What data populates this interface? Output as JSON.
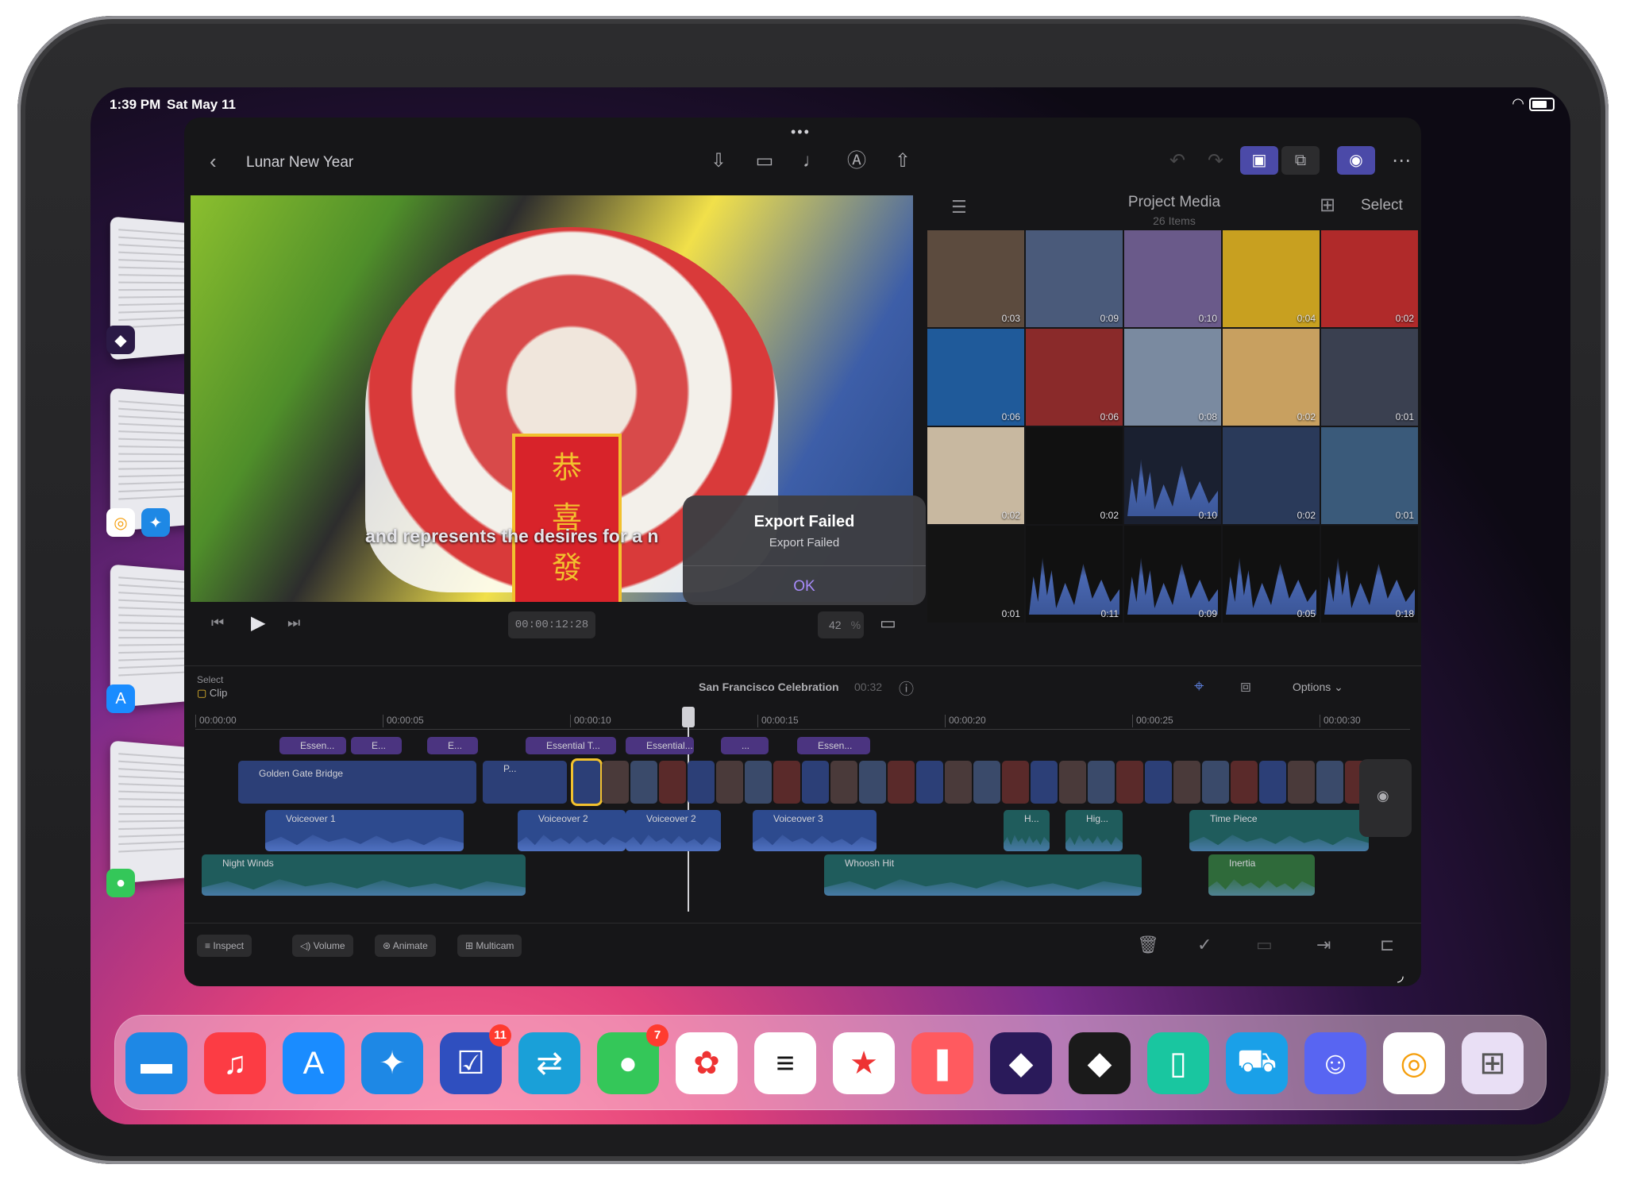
{
  "status": {
    "time": "1:39 PM",
    "date": "Sat May 11"
  },
  "app": {
    "project_title": "Lunar New Year",
    "viewer": {
      "subtitle": "and represents the desires for a n",
      "timecode": "00:00:12:28",
      "zoom": "42",
      "zoom_unit": "%",
      "banner_chars": [
        "恭",
        "喜",
        "發"
      ]
    },
    "dialog": {
      "title": "Export Failed",
      "message": "Export Failed",
      "ok": "OK"
    },
    "media": {
      "title": "Project Media",
      "count": "26 Items",
      "select": "Select",
      "thumbs": [
        {
          "dur": "0:03"
        },
        {
          "dur": "0:09"
        },
        {
          "dur": "0:10"
        },
        {
          "dur": "0:04"
        },
        {
          "dur": "0:02"
        },
        {
          "dur": "0:06"
        },
        {
          "dur": "0:06"
        },
        {
          "dur": "0:08"
        },
        {
          "dur": "0:02"
        },
        {
          "dur": "0:01"
        },
        {
          "dur": "0:02"
        },
        {
          "dur": "0:02"
        },
        {
          "dur": "0:10"
        },
        {
          "dur": "0:02"
        },
        {
          "dur": "0:01"
        },
        {
          "dur": "0:01"
        },
        {
          "dur": "0:11"
        },
        {
          "dur": "0:09"
        },
        {
          "dur": "0:05"
        },
        {
          "dur": "0:18"
        }
      ]
    },
    "timeline": {
      "select_label": "Select",
      "clip_label": "Clip",
      "project_name": "San Francisco Celebration",
      "duration": "00:32",
      "options": "Options",
      "ruler": [
        "00:00:00",
        "00:00:05",
        "00:00:10",
        "00:00:15",
        "00:00:20",
        "00:00:25",
        "00:00:30"
      ],
      "titles": [
        "Essen...",
        "E...",
        "E...",
        "Essential T...",
        "Essential...",
        "...",
        "Essen..."
      ],
      "main_clip": "Golden Gate Bridge",
      "main_clip_short": "P...",
      "voiceovers": [
        "Voiceover 1",
        "Voiceover 2",
        "Voiceover 2",
        "Voiceover 3",
        "H...",
        "Hig...",
        "Time Piece"
      ],
      "music": [
        "Night Winds",
        "Whoosh Hit",
        "Inertia"
      ]
    },
    "footer": {
      "inspect": "Inspect",
      "volume": "Volume",
      "animate": "Animate",
      "multicam": "Multicam"
    }
  },
  "dock": {
    "badges": {
      "tasks": "11",
      "messages": "7"
    },
    "icons": [
      "files-icon",
      "music-icon",
      "app-store-icon",
      "safari-icon",
      "tasks-icon",
      "transfer-icon",
      "messages-icon",
      "photos-icon",
      "notes-stack-icon",
      "bookmark-star-icon",
      "bookmark-icon",
      "shortcuts-icon",
      "obsidian-icon",
      "device-icon",
      "car-icon",
      "discord-icon",
      "speech-icon",
      "folder-apps-icon"
    ]
  }
}
